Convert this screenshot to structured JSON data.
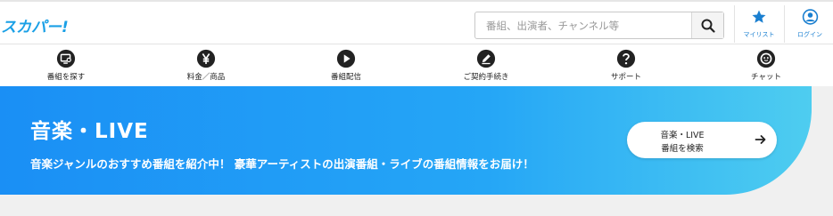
{
  "header": {
    "logo_text": "スカパー!",
    "search_placeholder": "番組、出演者、チャンネル等",
    "mylist_label": "マイリスト",
    "login_label": "ログイン"
  },
  "nav": {
    "items": [
      {
        "label": "番組を探す",
        "icon": "tv-search-icon"
      },
      {
        "label": "料金／商品",
        "icon": "yen-icon"
      },
      {
        "label": "番組配信",
        "icon": "play-icon"
      },
      {
        "label": "ご契約手続き",
        "icon": "pen-icon"
      },
      {
        "label": "サポート",
        "icon": "question-icon"
      },
      {
        "label": "チャット",
        "icon": "chat-bot-icon"
      }
    ]
  },
  "banner": {
    "title": "音楽・LIVE",
    "description": "音楽ジャンルのおすすめ番組を紹介中！ 豪華アーティストの出演番組・ライブの番組情報をお届け！",
    "button_line1": "音楽・LIVE",
    "button_line2": "番組を検索"
  },
  "colors": {
    "brand": "#1aa0e6",
    "link": "#1a7fd0",
    "banner_start": "#1a8ff5",
    "banner_end": "#4ecdf0"
  }
}
